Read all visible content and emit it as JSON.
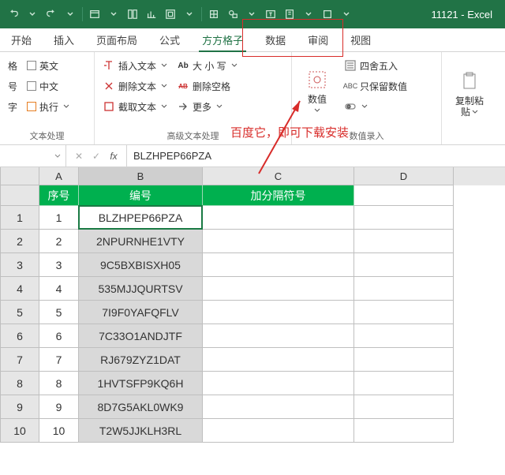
{
  "title": "11121 - Excel",
  "tabs": [
    "开始",
    "插入",
    "页面布局",
    "公式",
    "方方格子",
    "数据",
    "审阅",
    "视图"
  ],
  "active_tab": 4,
  "ribbon": {
    "g1": {
      "label": "文本处理",
      "col1": [
        {
          "l": "格"
        },
        {
          "l": "号"
        },
        {
          "l": "字"
        }
      ],
      "col2": [
        {
          "l": "英文"
        },
        {
          "l": "中文"
        },
        {
          "l": "执行"
        }
      ]
    },
    "g2": {
      "label": "高级文本处理",
      "col1": [
        {
          "l": "插入文本"
        },
        {
          "l": "删除文本"
        },
        {
          "l": "截取文本"
        }
      ],
      "col2": [
        {
          "l": "大 小 写"
        },
        {
          "l": "删除空格"
        },
        {
          "l": "更多"
        }
      ]
    },
    "g3": {
      "label": "数值录入",
      "big": "数值",
      "col": [
        {
          "l": "四舍五入"
        },
        {
          "l": "只保留数值"
        }
      ]
    },
    "g4": {
      "big1": "复制粘",
      "big2": "贴"
    }
  },
  "annotation": "百度它，即可下载安装",
  "formula_bar": {
    "value": "BLZHPEP66PZA"
  },
  "columns": [
    "A",
    "B",
    "C",
    "D"
  ],
  "header_row": {
    "a": "序号",
    "b": "编号",
    "c": "加分隔符号"
  },
  "rows": [
    {
      "n": "1",
      "b": "BLZHPEP66PZA"
    },
    {
      "n": "2",
      "b": "2NPURNHE1VTY"
    },
    {
      "n": "3",
      "b": "9C5BXBISXH05"
    },
    {
      "n": "4",
      "b": "535MJJQURTSV"
    },
    {
      "n": "5",
      "b": "7I9F0YAFQFLV"
    },
    {
      "n": "6",
      "b": "7C33O1ANDJTF"
    },
    {
      "n": "7",
      "b": "RJ679ZYZ1DAT"
    },
    {
      "n": "8",
      "b": "1HVTSFP9KQ6H"
    },
    {
      "n": "9",
      "b": "8D7G5AKL0WK9"
    },
    {
      "n": "10",
      "b": "T2W5JJKLH3RL"
    }
  ]
}
